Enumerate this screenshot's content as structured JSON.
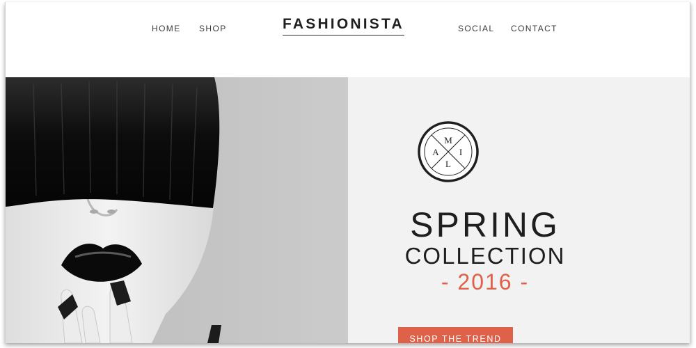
{
  "nav": {
    "left": [
      {
        "label": "HOME"
      },
      {
        "label": "SHOP"
      }
    ],
    "right": [
      {
        "label": "SOCIAL"
      },
      {
        "label": "CONTACT"
      }
    ],
    "logo": "FASHIONISTA"
  },
  "hero": {
    "badge": {
      "letters": [
        "M",
        "I",
        "L",
        "A"
      ]
    },
    "title_line1": "SPRING",
    "title_line2": "COLLECTION",
    "title_line3": "- 2016 -",
    "cta_label": "SHOP THE TREND"
  },
  "colors": {
    "accent": "#e0614a",
    "text_dark": "#1e1e1e",
    "panel_bg": "#f2f2f2"
  }
}
